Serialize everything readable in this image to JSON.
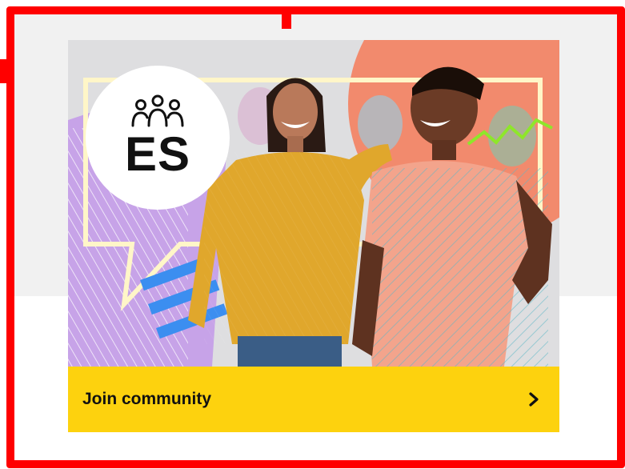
{
  "badge": {
    "text": "ES",
    "icon": "community-people-icon"
  },
  "cta": {
    "label": "Join community",
    "icon": "chevron-right-icon"
  },
  "colors": {
    "frame": "#ff0000",
    "cta_background": "#fdd20e",
    "badge_background": "#ffffff",
    "page_background": "#f1f1f1"
  }
}
